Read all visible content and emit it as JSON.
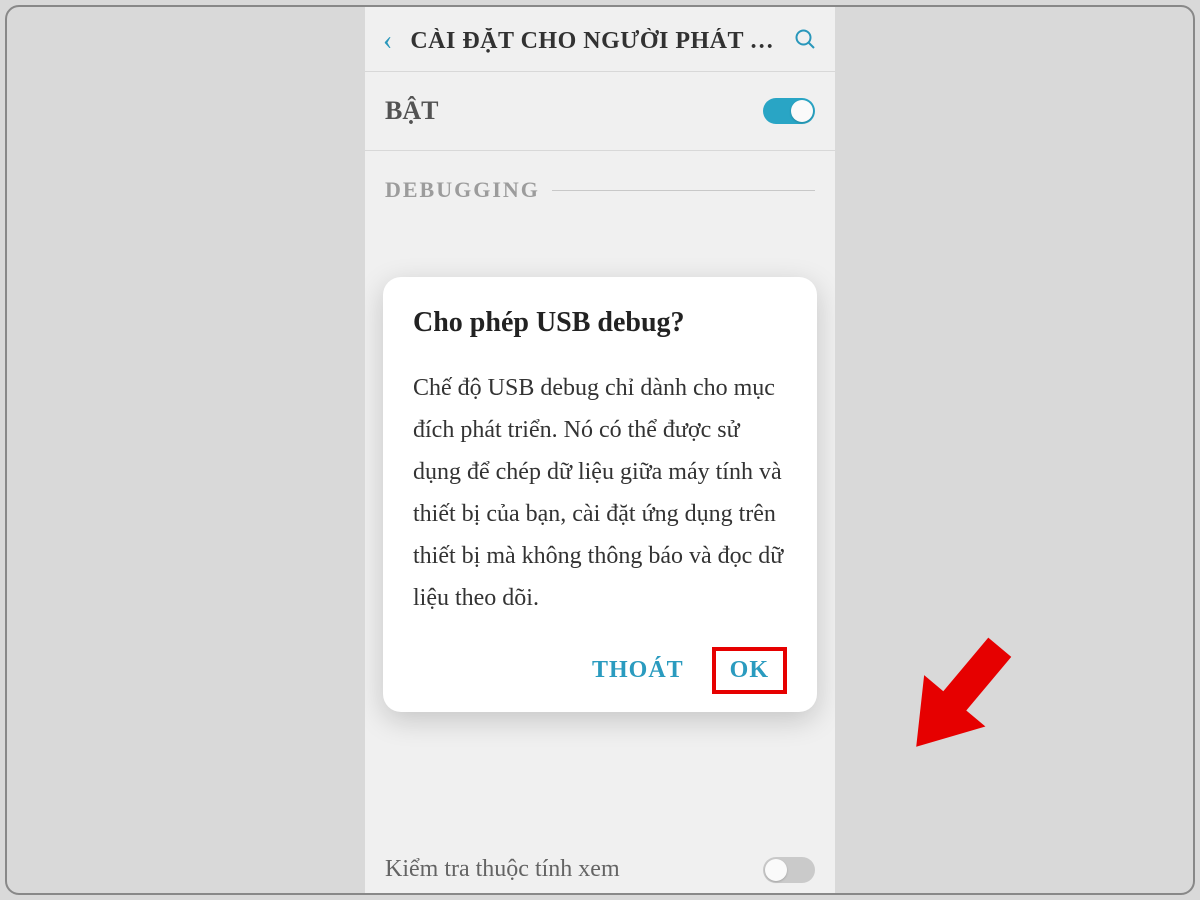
{
  "header": {
    "back_icon": "‹",
    "title": "CÀI ĐẶT CHO NGƯỜI PHÁT TR…"
  },
  "enable_row": {
    "label": "BẬT",
    "state": true
  },
  "section": {
    "title": "DEBUGGING"
  },
  "dialog": {
    "title": "Cho phép USB debug?",
    "body": "Chế độ USB debug chỉ dành cho mục đích phát triển. Nó có thể được sử dụng để chép dữ liệu giữa máy tính và thiết bị của bạn, cài đặt ứng dụng trên thiết bị mà không thông báo và đọc dữ liệu theo dõi.",
    "cancel_label": "THOÁT",
    "ok_label": "OK"
  },
  "bottom_hint": "Kiểm tra thuộc tính xem",
  "annotation": {
    "highlight_target": "ok-button",
    "highlight_color": "#e60000"
  }
}
